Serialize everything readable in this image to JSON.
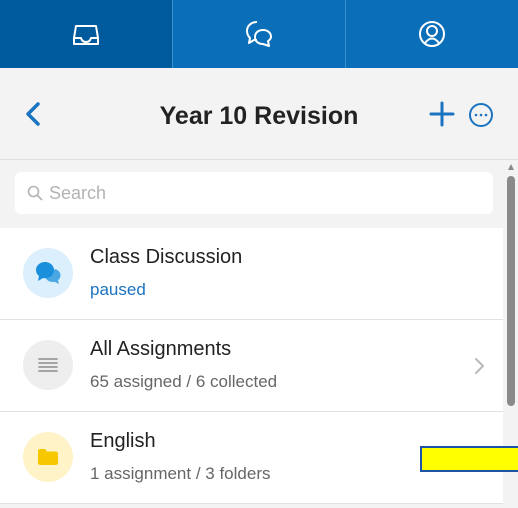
{
  "tabs": [
    {
      "icon": "inbox-icon",
      "active": true
    },
    {
      "icon": "chat-icon",
      "active": false
    },
    {
      "icon": "profile-icon",
      "active": false
    }
  ],
  "header": {
    "title": "Year 10 Revision"
  },
  "search": {
    "placeholder": "Search"
  },
  "list": [
    {
      "title": "Class Discussion",
      "subtitle": "paused",
      "icon": "discussion-icon",
      "icon_bg": "#dbeffc",
      "icon_color": "#1a8fdc"
    },
    {
      "title": "All Assignments",
      "subtitle": "65 assigned / 6 collected",
      "icon": "list-icon",
      "icon_bg": "#eeeeee",
      "icon_color": "#9a9a9a"
    },
    {
      "title": "English",
      "subtitle": "1 assignment / 3 folders",
      "icon": "folder-icon",
      "icon_bg": "#fff3c7",
      "icon_color": "#f7c800"
    }
  ],
  "colors": {
    "brand": "#0a6fb8",
    "brand_active": "#005a9e",
    "accent": "#1a73c0",
    "highlight": "#ffff00"
  }
}
